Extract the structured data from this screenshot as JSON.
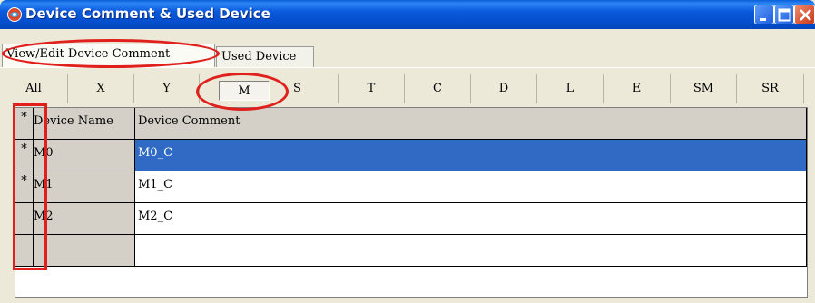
{
  "window": {
    "title": "Device Comment & Used Device",
    "controls": [
      "minimize",
      "maximize",
      "close"
    ]
  },
  "tabs": [
    {
      "label": "View/Edit Device Comment",
      "active": true
    },
    {
      "label": "Used Device",
      "active": false
    }
  ],
  "device_buttons": [
    "All",
    "X",
    "Y",
    "M",
    "S",
    "T",
    "C",
    "D",
    "L",
    "E",
    "SM",
    "SR"
  ],
  "selected_device": "M",
  "grid": {
    "header": {
      "mark": "*",
      "name": "Device Name",
      "comment": "Device Comment"
    },
    "rows": [
      {
        "mark": "*",
        "name": "M0",
        "comment": "M0_C",
        "selected": true
      },
      {
        "mark": "*",
        "name": "M1",
        "comment": "M1_C",
        "selected": false
      },
      {
        "mark": "",
        "name": "M2",
        "comment": "M2_C",
        "selected": false
      },
      {
        "mark": "",
        "name": "",
        "comment": "",
        "selected": false
      }
    ]
  },
  "colors": {
    "titlebar": "#0b59dc",
    "selection": "#316ac5",
    "annotation": "#e0201c",
    "face": "#ece9d8"
  }
}
